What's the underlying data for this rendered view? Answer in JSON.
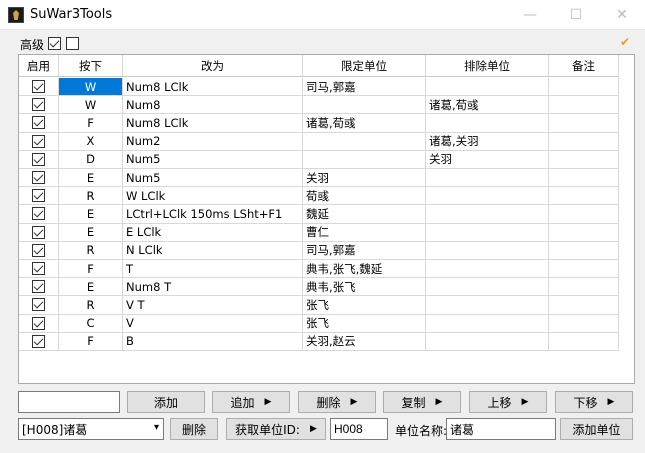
{
  "window": {
    "title": "SuWar3Tools"
  },
  "top": {
    "advanced_label": "高级",
    "cb1_checked": true,
    "cb2_checked": false
  },
  "grid": {
    "headers": [
      "启用",
      "按下",
      "改为",
      "限定单位",
      "排除单位",
      "备注"
    ],
    "rows": [
      {
        "enabled": true,
        "key": "W",
        "action": "Num8 LClk",
        "limit": "司马,郭嘉",
        "exclude": "",
        "note": "",
        "selected": true
      },
      {
        "enabled": true,
        "key": "W",
        "action": "Num8",
        "limit": "",
        "exclude": "诸葛,荀彧",
        "note": ""
      },
      {
        "enabled": true,
        "key": "F",
        "action": "Num8 LClk",
        "limit": "诸葛,荀彧",
        "exclude": "",
        "note": ""
      },
      {
        "enabled": true,
        "key": "X",
        "action": "Num2",
        "limit": "",
        "exclude": "诸葛,关羽",
        "note": ""
      },
      {
        "enabled": true,
        "key": "D",
        "action": "Num5",
        "limit": "",
        "exclude": "关羽",
        "note": ""
      },
      {
        "enabled": true,
        "key": "E",
        "action": "Num5",
        "limit": "关羽",
        "exclude": "",
        "note": ""
      },
      {
        "enabled": true,
        "key": "R",
        "action": "W LClk",
        "limit": "荀彧",
        "exclude": "",
        "note": ""
      },
      {
        "enabled": true,
        "key": "E",
        "action": "LCtrl+LClk 150ms LSht+F1",
        "limit": "魏延",
        "exclude": "",
        "note": ""
      },
      {
        "enabled": true,
        "key": "E",
        "action": "E LClk",
        "limit": "曹仁",
        "exclude": "",
        "note": ""
      },
      {
        "enabled": true,
        "key": "R",
        "action": "N LClk",
        "limit": "司马,郭嘉",
        "exclude": "",
        "note": ""
      },
      {
        "enabled": true,
        "key": "F",
        "action": "T",
        "limit": "典韦,张飞,魏延",
        "exclude": "",
        "note": ""
      },
      {
        "enabled": true,
        "key": "E",
        "action": "Num8 T",
        "limit": "典韦,张飞",
        "exclude": "",
        "note": ""
      },
      {
        "enabled": true,
        "key": "R",
        "action": "V T",
        "limit": "张飞",
        "exclude": "",
        "note": ""
      },
      {
        "enabled": true,
        "key": "C",
        "action": "V",
        "limit": "张飞",
        "exclude": "",
        "note": ""
      },
      {
        "enabled": true,
        "key": "F",
        "action": "B",
        "limit": "关羽,赵云",
        "exclude": "",
        "note": ""
      }
    ]
  },
  "row1": {
    "input_value": "",
    "add": "添加",
    "append": "追加",
    "delete": "删除",
    "copy": "复制",
    "move_up": "上移",
    "move_down": "下移"
  },
  "row2": {
    "unit_select": "[H008]诸葛",
    "delete": "删除",
    "get_unit_id": "获取单位ID:",
    "unit_id_value": "H008",
    "unit_name_label": "单位名称:",
    "unit_name_value": "诸葛",
    "add_unit": "添加单位"
  },
  "colors": {
    "selection": "#0078d7",
    "accent_check": "#e8a020"
  }
}
